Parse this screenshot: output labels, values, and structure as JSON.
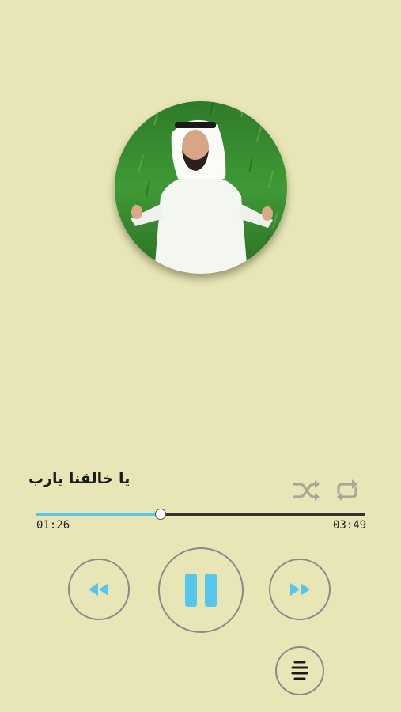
{
  "player": {
    "track_title": "يا خالقنا يارب",
    "elapsed": "01:26",
    "total": "03:49",
    "progress": 0.378
  },
  "controls": {
    "shuffle_icon": "shuffle-icon",
    "repeat_icon": "repeat-icon",
    "rewind_icon": "rewind-icon",
    "pause_icon": "pause-icon",
    "forward_icon": "fast-forward-icon",
    "playlist_icon": "playlist-icon"
  },
  "colors": {
    "background": "#e8e6b6",
    "accent": "#56c6ea",
    "track": "#333333",
    "control_border": "#8a8a8a",
    "inactive_icon": "#a8a89a"
  }
}
